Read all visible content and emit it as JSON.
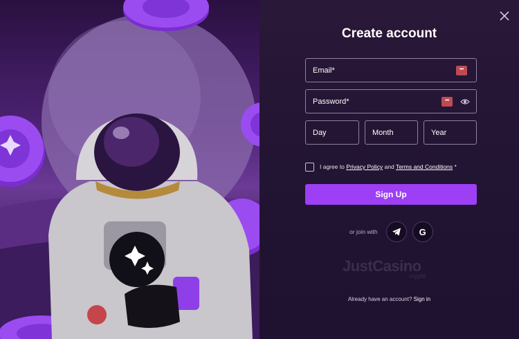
{
  "modal": {
    "title": "Create account",
    "close_icon": "close-icon"
  },
  "form": {
    "email_label": "Email*",
    "password_label": "Password*",
    "day_label": "Day",
    "month_label": "Month",
    "year_label": "Year",
    "agree_prefix": "I agree to ",
    "privacy_policy": "Privacy Policy",
    "and": " and ",
    "terms": "Terms and Conditions",
    "agree_suffix": " *",
    "signup_label": "Sign Up"
  },
  "social": {
    "or_join": "or join with",
    "providers": [
      "telegram-icon",
      "google-icon"
    ],
    "google_letter": "G"
  },
  "brand": {
    "logo": "JustCasino",
    "logo_sub": "crypto"
  },
  "footer": {
    "already": "Already have an account? ",
    "signin": "Sign in"
  },
  "colors": {
    "accent": "#9c3ff5",
    "panel_bg": "#221433",
    "field_border": "#8c83a0",
    "warning_icon": "#c04a52"
  }
}
